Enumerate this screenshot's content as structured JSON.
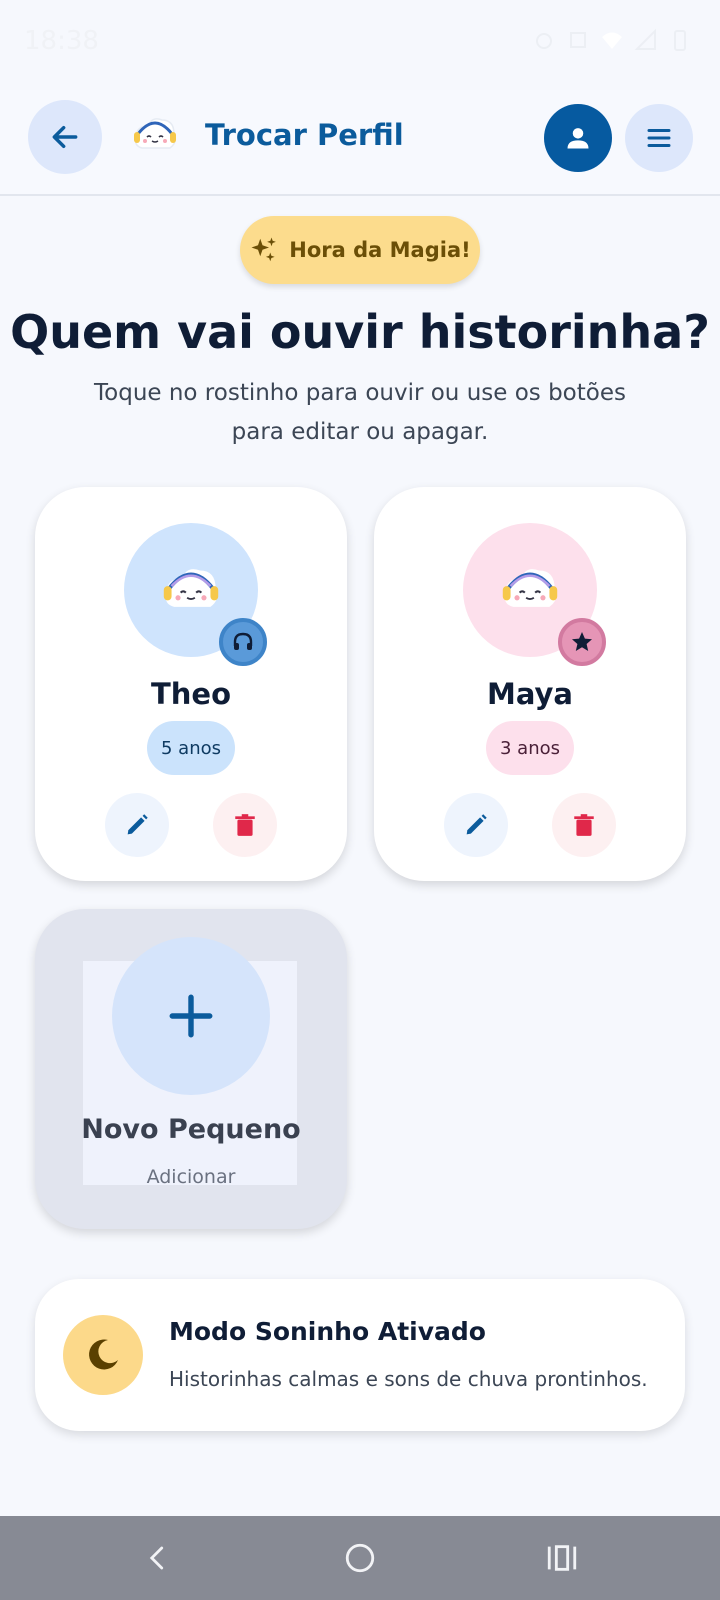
{
  "status_bar": {
    "time": "18:38",
    "icons": [
      "alarm-icon",
      "data-icon",
      "wifi-icon",
      "signal-icon",
      "battery-icon"
    ]
  },
  "app_bar": {
    "title": "Trocar Perfil",
    "back_icon": "arrow-left-icon",
    "profile_icon": "person-icon",
    "menu_icon": "hamburger-icon"
  },
  "magic_pill": {
    "label": "Hora da Magia!",
    "icon": "sparkles-icon"
  },
  "heading": {
    "title": "Quem vai ouvir historinha?",
    "subtitle": "Toque no rostinho para ouvir ou use os botões para editar ou apagar."
  },
  "profiles": [
    {
      "name": "Theo",
      "age": "5 anos",
      "badge_icon": "headphones-icon",
      "color": "#cfe4fd"
    },
    {
      "name": "Maya",
      "age": "3 anos",
      "badge_icon": "star-icon",
      "color": "#fde0ec"
    }
  ],
  "add_profile": {
    "title": "Novo Pequeno",
    "subtitle": "Adicionar",
    "icon": "plus-icon"
  },
  "sleep_mode": {
    "title": "Modo Soninho Ativado",
    "description": "Historinhas calmas e sons de chuva prontinhos.",
    "icon": "moon-icon"
  },
  "colors": {
    "primary": "#065aa0",
    "accent": "#fcdc8d",
    "danger": "#e0284a",
    "background": "#f6f8fd"
  }
}
